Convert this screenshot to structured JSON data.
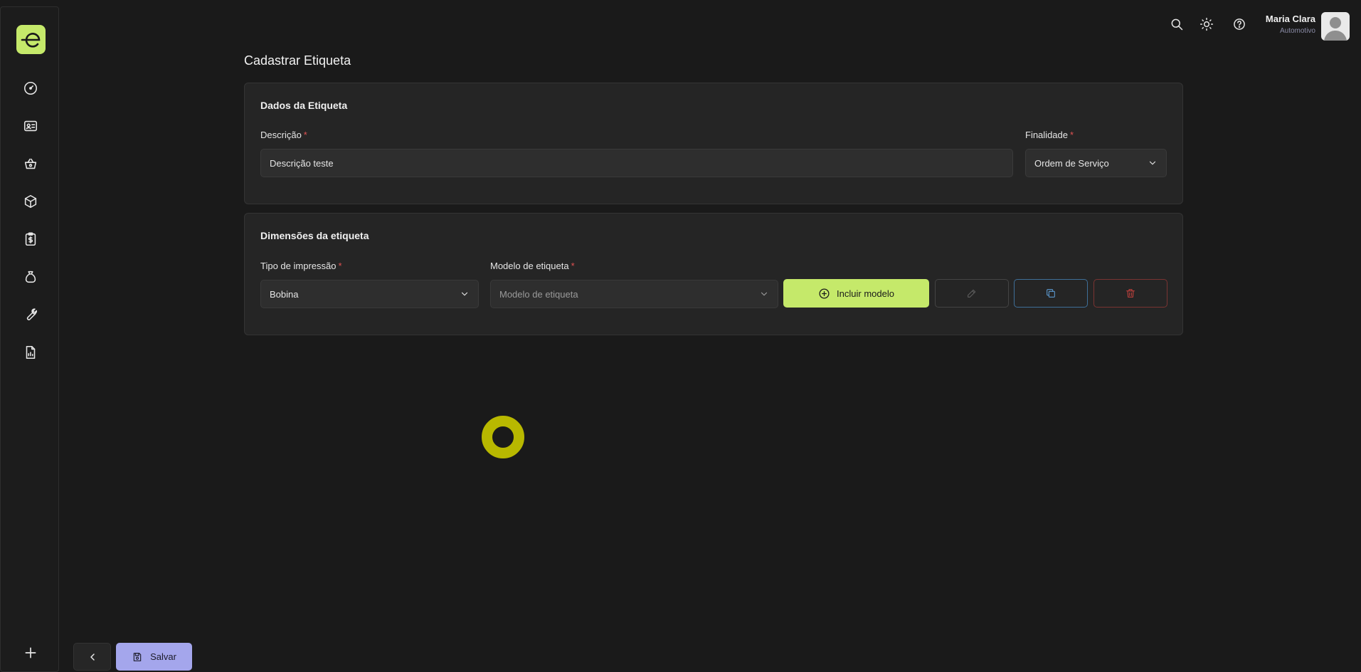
{
  "sidebar": {
    "items": [
      {
        "name": "dashboard-gauge-icon"
      },
      {
        "name": "contact-card-icon"
      },
      {
        "name": "shopping-basket-icon"
      },
      {
        "name": "package-box-icon"
      },
      {
        "name": "clipboard-dollar-icon"
      },
      {
        "name": "money-bag-icon"
      },
      {
        "name": "wrench-icon"
      },
      {
        "name": "report-chart-icon"
      }
    ],
    "add_icon": "plus-icon"
  },
  "header": {
    "user_name": "Maria Clara",
    "user_subtitle": "Automotivo"
  },
  "page": {
    "title": "Cadastrar Etiqueta"
  },
  "card_dados": {
    "title": "Dados da Etiqueta",
    "descricao_label": "Descrição",
    "descricao_value": "Descrição teste",
    "finalidade_label": "Finalidade",
    "finalidade_value": "Ordem de Serviço"
  },
  "card_dimensoes": {
    "title": "Dimensões da etiqueta",
    "tipo_label": "Tipo de impressão",
    "tipo_value": "Bobina",
    "modelo_label": "Modelo de etiqueta",
    "modelo_placeholder": "Modelo de etiqueta",
    "incluir_label": "Incluir modelo"
  },
  "required_mark": "*",
  "footer": {
    "save_label": "Salvar"
  },
  "colors": {
    "accent": "#c5e96a",
    "save": "#a4a6ec",
    "danger": "#c0403c",
    "info": "#4a90c8",
    "spinner": "#b8b800"
  }
}
